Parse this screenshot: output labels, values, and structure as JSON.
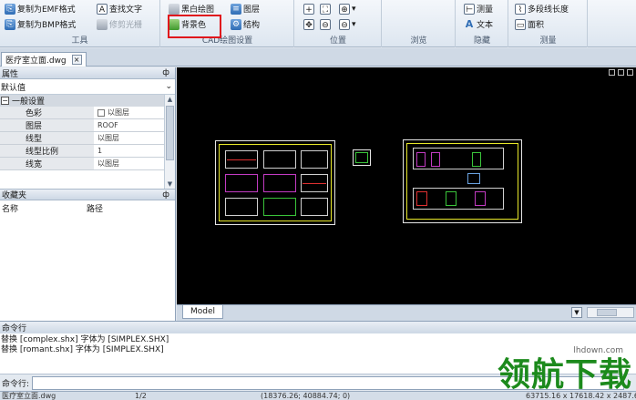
{
  "ribbon": {
    "tools": {
      "caption": "工具",
      "emf": "复制为EMF格式",
      "bmp": "复制为BMP格式",
      "find_text": "查找文字",
      "trim_raster": "修剪光栅"
    },
    "cad_settings": {
      "caption": "CAD绘图设置",
      "black_white": "黑白绘图",
      "background": "背景色",
      "layers": "图层",
      "structure": "结构"
    },
    "position": {
      "caption": "位置"
    },
    "browse": {
      "caption": "浏览"
    },
    "hidden": {
      "caption": "隐藏",
      "measure": "测量",
      "text": "文本"
    },
    "measure": {
      "caption": "测量",
      "polyline_length": "多段线长度",
      "area": "面积"
    }
  },
  "doc_tab": {
    "label": "医疗室立面.dwg",
    "close": "×"
  },
  "properties": {
    "title": "属性",
    "pin": "ф",
    "dropdown_value": "默认值",
    "category": "一般设置",
    "rows": [
      {
        "key": "色彩",
        "value": "以图层",
        "swatch": true
      },
      {
        "key": "图层",
        "value": "ROOF"
      },
      {
        "key": "线型",
        "value": "以图层"
      },
      {
        "key": "线型比例",
        "value": "1"
      },
      {
        "key": "线宽",
        "value": "以图层"
      }
    ]
  },
  "favorites": {
    "title": "收藏夹",
    "pin": "ф",
    "col_name": "名称",
    "col_path": "路径"
  },
  "layout_tab": "Model",
  "command": {
    "title": "命令行",
    "lines": [
      "替换 [complex.shx] 字体为 [SIMPLEX.SHX]",
      "替换 [romant.shx] 字体为 [SIMPLEX.SHX]"
    ],
    "prompt": "命令行:"
  },
  "status": {
    "file": "医疗室立面.dwg",
    "page": "1/2",
    "coords": "(18376.26; 40884.74; 0)",
    "size": "63715.16 x 17618.42 x 2487.6"
  },
  "watermark": {
    "site": "lhdown.com",
    "text": "领航下载"
  },
  "colors": {
    "highlight": "#e0141c",
    "frame": "#e8e82a",
    "canvas": "#000000"
  }
}
